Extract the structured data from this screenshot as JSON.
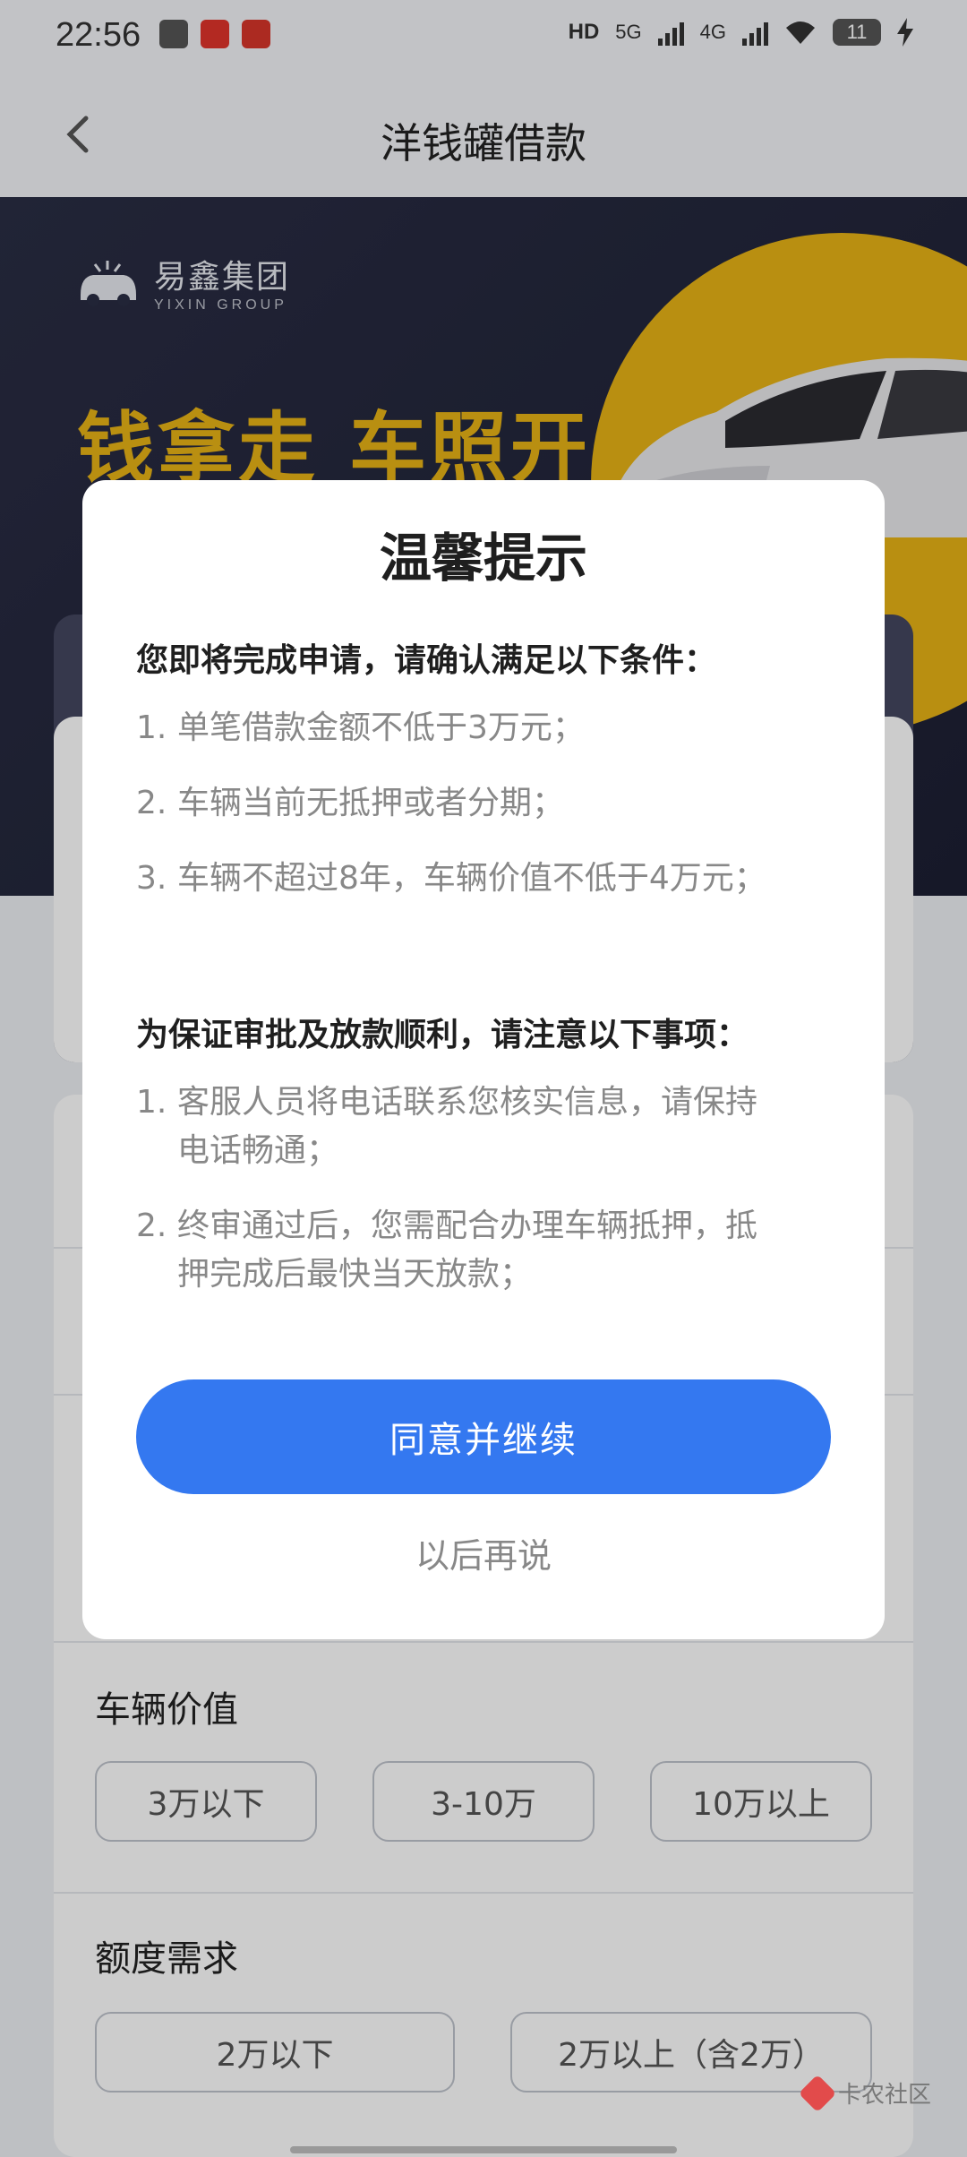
{
  "status_bar": {
    "time": "22:56",
    "hd_label": "HD",
    "net1": "5G",
    "net2": "4G",
    "battery": "11"
  },
  "nav": {
    "title": "洋钱罐借款"
  },
  "hero": {
    "brand_cn": "易鑫集团",
    "brand_en": "YIXIN GROUP",
    "slogan": "钱拿走 车照开",
    "colors": {
      "accent": "#e8b316",
      "bg": "#22253a"
    }
  },
  "form": {
    "vehicle_value_label": "车辆价值",
    "vehicle_value_options": [
      "3万以下",
      "3-10万",
      "10万以上"
    ],
    "amount_label": "额度需求",
    "amount_options": [
      "2万以下",
      "2万以上（含2万）"
    ]
  },
  "dialog": {
    "title": "温馨提示",
    "section1_title": "您即将完成申请，请确认满足以下条件：",
    "section1_items": [
      {
        "num": "1.",
        "text": "单笔借款金额不低于3万元；"
      },
      {
        "num": "2.",
        "text": "车辆当前无抵押或者分期；"
      },
      {
        "num": "3.",
        "text": "车辆不超过8年，车辆价值不低于4万元；"
      }
    ],
    "section2_title": "为保证审批及放款顺利，请注意以下事项：",
    "section2_items": [
      {
        "num": "1.",
        "text": "客服人员将电话联系您核实信息，请保持电话畅通；"
      },
      {
        "num": "2.",
        "text": "终审通过后，您需配合办理车辆抵押，抵押完成后最快当天放款；"
      }
    ],
    "agree_button": "同意并继续",
    "later_link": "以后再说",
    "primary_color": "#3478f0"
  },
  "watermark": {
    "text": "卡农社区"
  }
}
